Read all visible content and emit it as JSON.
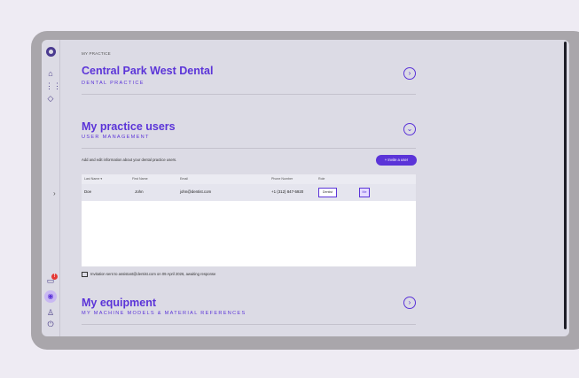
{
  "sidebar": {
    "logo_icon": "brand-logo-icon",
    "icons": [
      "home-icon",
      "grid-icon",
      "graduation-cap-icon"
    ],
    "expand_glyph": "›",
    "bottom_icons": [
      "tray-icon",
      "clinic-icon",
      "user-icon",
      "power-icon"
    ],
    "notification_count": "!",
    "accent": "#5b34d8"
  },
  "breadcrumb": "MY PRACTICE",
  "practice": {
    "title": "Central Park West Dental",
    "subtitle": "DENTAL PRACTICE",
    "toggle": "›"
  },
  "users": {
    "title": "My practice users",
    "subtitle": "USER MANAGEMENT",
    "toggle": "⌄",
    "description": "Add and edit information about your dental practice users.",
    "invite_button": "+  Invite a user",
    "columns": [
      "Last Name",
      "First Name",
      "Email",
      "Phone Number",
      "Role"
    ],
    "sort_glyph": "▾",
    "rows": [
      {
        "last": "Doe",
        "first": "John",
        "email": "john@dentist.com",
        "phone": "+1 (312) 847-5920",
        "role": "Dentist",
        "badge": "Me"
      }
    ],
    "invitation_note": "Invitation sent to assistant@dentist.com on 09 April 2026, awaiting response"
  },
  "equipment": {
    "title": "My equipment",
    "subtitle": "MY MACHINE MODELS & MATERIAL REFERENCES",
    "toggle": "›"
  }
}
